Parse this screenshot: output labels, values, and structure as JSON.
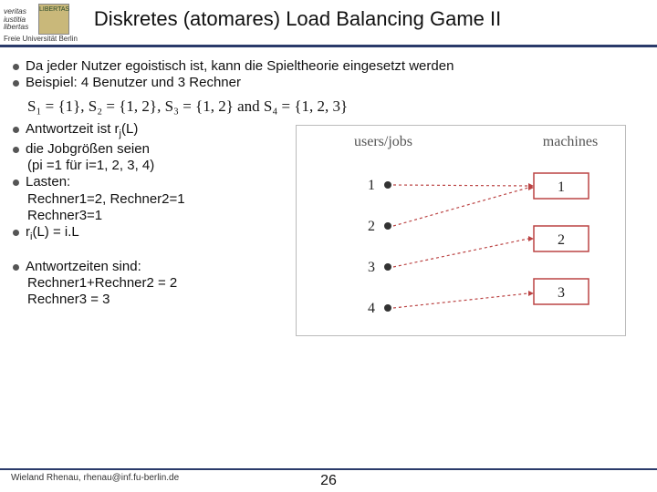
{
  "header": {
    "motto1": "veritas",
    "motto2": "iustitia",
    "motto3": "libertas",
    "seal": "LIBERTAS",
    "university": "Freie Universität Berlin",
    "title": "Diskretes (atomares) Load Balancing Game II"
  },
  "bullets": {
    "b1": "Da jeder Nutzer egoistisch ist, kann die Spieltheorie eingesetzt werden",
    "b2": "Beispiel: 4 Benutzer und 3 Rechner",
    "formula": "S₁ = {1}, S₂ = {1, 2}, S₃ = {1, 2} and S₄ = {1, 2, 3}",
    "b3a": "Antwortzeit ist r",
    "b3b": "(L)",
    "b3sub": "j",
    "b4": "die Jobgrößen seien",
    "b4a": "(pi =1 für i=1, 2, 3, 4)",
    "b5": "Lasten:",
    "b5a": "Rechner1=2, Rechner2=1",
    "b5b": "Rechner3=1",
    "b6a": "r",
    "b6sub": "i",
    "b6b": "(L) = i.L",
    "b7": "Antwortzeiten sind:",
    "b7a": "Rechner1+Rechner2 = 2",
    "b7b": "Rechner3 = 3"
  },
  "diagram": {
    "left_label": "users/jobs",
    "right_label": "machines",
    "users": [
      "1",
      "2",
      "3",
      "4"
    ],
    "machines": [
      "1",
      "2",
      "3"
    ]
  },
  "footer": {
    "author": "Wieland Rhenau, rhenau@inf.fu-berlin.de",
    "page": "26"
  }
}
